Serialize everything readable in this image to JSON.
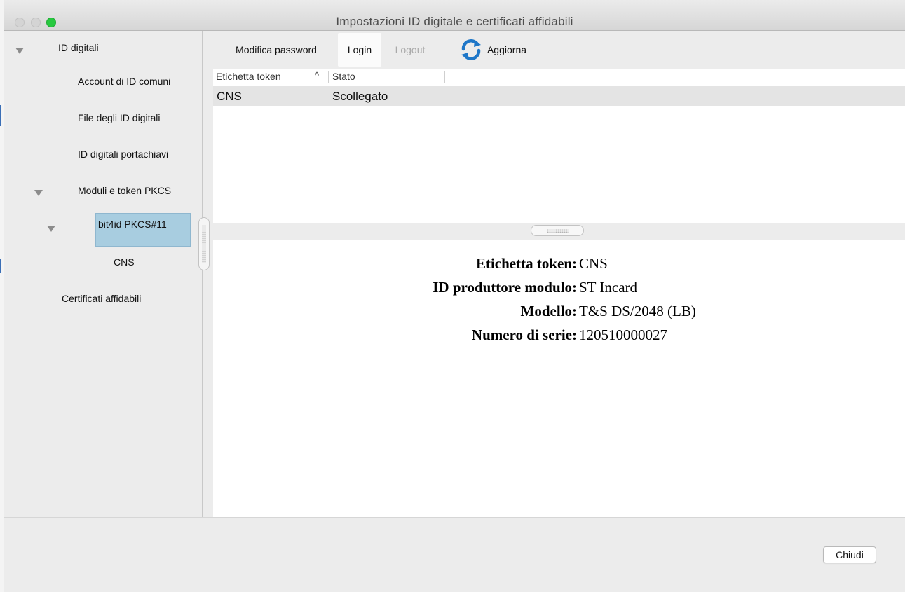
{
  "window": {
    "title": "Impostazioni ID digitale e certificati affidabili"
  },
  "sidebar": {
    "items": [
      {
        "label": "ID digitali",
        "expanded": true
      },
      {
        "label": "Account di ID comuni"
      },
      {
        "label": "File degli ID digitali"
      },
      {
        "label": "ID digitali portachiavi"
      },
      {
        "label": "Moduli e token PKCS",
        "expanded": true
      },
      {
        "label": "bit4id PKCS#11",
        "expanded": true,
        "selected": true
      },
      {
        "label": "CNS"
      },
      {
        "label": "Certificati affidabili"
      }
    ]
  },
  "toolbar": {
    "change_password": "Modifica password",
    "login": "Login",
    "logout": "Logout",
    "refresh": "Aggiorna",
    "refresh_icon": "refresh-icon"
  },
  "table": {
    "columns": [
      "Etichetta token",
      "Stato"
    ],
    "sort_indicator": "^",
    "rows": [
      {
        "token_label": "CNS",
        "status": "Scollegato"
      }
    ]
  },
  "details": {
    "token_label": {
      "key": "Etichetta token:",
      "value": "CNS"
    },
    "manufacturer": {
      "key": "ID produttore modulo:",
      "value": "ST Incard"
    },
    "model": {
      "key": "Modello:",
      "value": "T&S DS/2048 (LB)"
    },
    "serial": {
      "key": "Numero di serie:",
      "value": "120510000027"
    }
  },
  "footer": {
    "close_label": "Chiudi"
  },
  "colors": {
    "selection": "#a8cde0",
    "zoom_button": "#27c93f",
    "refresh_icon": "#1f77c8"
  }
}
